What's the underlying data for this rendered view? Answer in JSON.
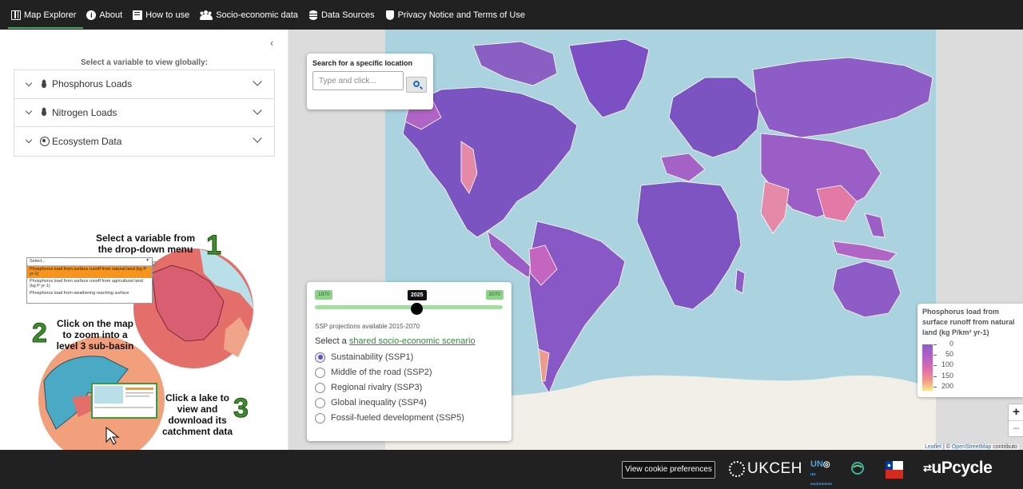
{
  "nav": {
    "items": [
      {
        "label": "Map Explorer",
        "icon": "map-icon",
        "active": true
      },
      {
        "label": "About",
        "icon": "info-icon"
      },
      {
        "label": "How to use",
        "icon": "book-icon"
      },
      {
        "label": "Socio-economic data",
        "icon": "people-icon"
      },
      {
        "label": "Data Sources",
        "icon": "database-icon"
      },
      {
        "label": "Privacy Notice and Terms of Use",
        "icon": "shield-icon"
      }
    ],
    "accent": "#47a76a"
  },
  "sidebar": {
    "select_title": "Select a variable to view globally:",
    "accordion": [
      {
        "label": "Phosphorus Loads",
        "icon": "droplet-icon"
      },
      {
        "label": "Nitrogen Loads",
        "icon": "droplet-icon"
      },
      {
        "label": "Ecosystem Data",
        "icon": "ecosystem-icon"
      }
    ],
    "instructions": {
      "step1_text": "Select a variable from the drop-down menu",
      "step1_num": "1",
      "step2_text": "Click on the map to zoom into a level 3 sub-basin",
      "step2_num": "2",
      "step3_text": "Click a lake to view and download its catchment data",
      "step3_num": "3",
      "mini_select_placeholder": "Select...",
      "mini_select_options": [
        "Phosphorus load from surface runoff from natural land (kg P yr-1)",
        "Phosphorus load from surface runoff from agricultural land (kg P yr-1)",
        "Phosphorus load from weathering reaching surface"
      ]
    }
  },
  "search": {
    "label": "Search for a specific location",
    "placeholder": "Type and click..."
  },
  "scenario": {
    "year_min": "1970",
    "year_current": "2025",
    "year_max": "2070",
    "year_fraction": 0.55,
    "ssp_note": "SSP projections available 2015-2070",
    "select_prefix": "Select a",
    "select_link": "shared socio-economic scenario",
    "options": [
      {
        "label": "Sustainability (SSP1)",
        "selected": true
      },
      {
        "label": "Middle of the road (SSP2)",
        "selected": false
      },
      {
        "label": "Regional rivalry (SSP3)",
        "selected": false
      },
      {
        "label": "Global inequality (SSP4)",
        "selected": false
      },
      {
        "label": "Fossil-fueled development (SSP5)",
        "selected": false
      }
    ]
  },
  "legend": {
    "title": "Phosphorus load from surface runoff from natural land (kg P/km² yr-1)",
    "ticks": [
      "0",
      "50",
      "100",
      "150",
      "200"
    ],
    "colors": [
      "#8a5fc4",
      "#b160c8",
      "#de6fa8",
      "#f29a86",
      "#fbe78b"
    ]
  },
  "zoom": {
    "in": "+",
    "out": "−"
  },
  "attribution": {
    "leaflet": "Leaflet",
    "separator": " | © ",
    "osm": "OpenStreetMap",
    "suffix": " contributo"
  },
  "footer": {
    "cookie_button": "View cookie preferences",
    "ukceh": "UKCEH",
    "un_text": "UN environment",
    "upcycle": "uPcycle"
  }
}
